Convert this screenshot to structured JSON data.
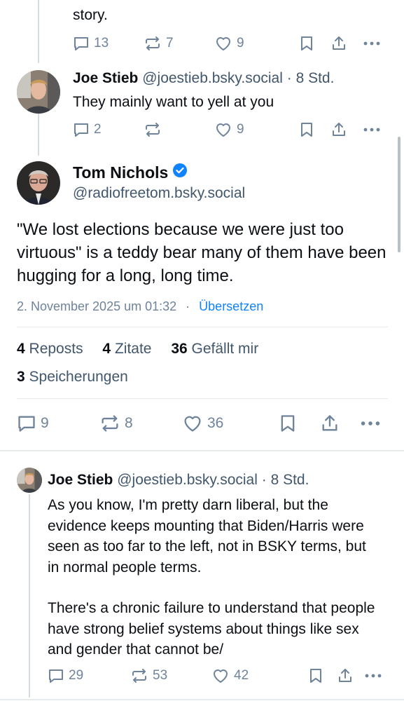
{
  "post_top": {
    "body_tail": "story.",
    "replies": "13",
    "reposts": "7",
    "likes": "9"
  },
  "reply_joe1": {
    "name": "Joe Stieb",
    "handle": "@joestieb.bsky.social",
    "time": "· 8 Std.",
    "body": "They mainly want to yell at you",
    "replies": "2",
    "reposts": "",
    "likes": "9"
  },
  "main_post": {
    "name": "Tom Nichols",
    "handle": "@radiofreetom.bsky.social",
    "body": "\"We lost elections because we were just too virtuous\" is a teddy bear many of them have been hugging for a long, long time.",
    "date": "2. November 2025 um 01:32",
    "separator": "·",
    "translate": "Übersetzen",
    "stats": {
      "reposts_num": "4",
      "reposts_lbl": "Reposts",
      "quotes_num": "4",
      "quotes_lbl": "Zitate",
      "likes_num": "36",
      "likes_lbl": "Gefällt mir",
      "saves_num": "3",
      "saves_lbl": "Speicherungen"
    },
    "replies": "9",
    "reposts": "8",
    "likes": "36"
  },
  "reply_joe2": {
    "name": "Joe Stieb",
    "handle": "@joestieb.bsky.social",
    "time": "· 8 Std.",
    "body_p1": "As you know, I'm pretty darn liberal, but the evidence keeps mounting that Biden/Harris were seen as too far to the left, not in BSKY terms, but in normal people terms.",
    "body_p2": "There's a chronic failure to understand that people have strong belief systems about things like sex and gender that cannot be/",
    "replies": "29",
    "reposts": "53",
    "likes": "42"
  },
  "icons": [
    "reply-icon",
    "repost-icon",
    "like-icon",
    "bookmark-icon",
    "share-icon",
    "more-icon",
    "verified-icon"
  ],
  "colors": {
    "accent": "#1083fe",
    "muted": "#6f839a",
    "text": "#0b0f14",
    "divider": "#e6ebf0"
  }
}
